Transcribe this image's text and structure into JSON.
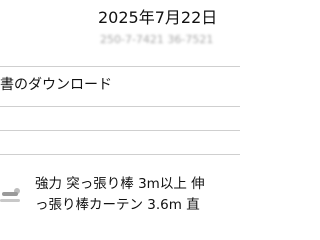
{
  "order": {
    "date": "2025年7月22日",
    "number": "250-7-7421 36-7521"
  },
  "receipt": {
    "label": "書のダウンロード"
  },
  "product": {
    "title_line1": "強力 突っ張り棒 3m以上 伸",
    "title_line2": "っ張り棒カーテン 3.6m 直"
  }
}
